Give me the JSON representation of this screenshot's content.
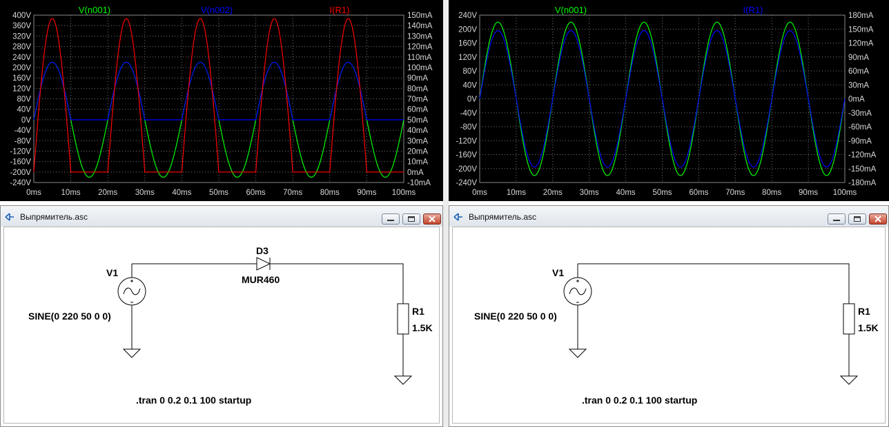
{
  "plots": [
    {
      "yLeftTicks": [
        "400V",
        "360V",
        "320V",
        "280V",
        "240V",
        "200V",
        "160V",
        "120V",
        "80V",
        "40V",
        "0V",
        "-40V",
        "-80V",
        "-120V",
        "-160V",
        "-200V",
        "-240V"
      ],
      "yRightTicks": [
        "150mA",
        "140mA",
        "130mA",
        "120mA",
        "110mA",
        "100mA",
        "90mA",
        "80mA",
        "70mA",
        "60mA",
        "50mA",
        "40mA",
        "30mA",
        "20mA",
        "10mA",
        "0mA",
        "-10mA"
      ],
      "xTicks": [
        "0ms",
        "10ms",
        "20ms",
        "30ms",
        "40ms",
        "50ms",
        "60ms",
        "70ms",
        "80ms",
        "90ms",
        "100ms"
      ],
      "traces": [
        {
          "label": "V(n001)",
          "color": "#00ff00"
        },
        {
          "label": "V(n002)",
          "color": "#0000ff"
        },
        {
          "label": "I(R1)",
          "color": "#ff0000"
        }
      ]
    },
    {
      "yLeftTicks": [
        "240V",
        "200V",
        "160V",
        "120V",
        "80V",
        "40V",
        "0V",
        "-40V",
        "-80V",
        "-120V",
        "-160V",
        "-200V",
        "-240V"
      ],
      "yRightTicks": [
        "180mA",
        "150mA",
        "120mA",
        "90mA",
        "60mA",
        "30mA",
        "0mA",
        "-30mA",
        "-60mA",
        "-90mA",
        "-120mA",
        "-150mA",
        "-180mA"
      ],
      "xTicks": [
        "0ms",
        "10ms",
        "20ms",
        "30ms",
        "40ms",
        "50ms",
        "60ms",
        "70ms",
        "80ms",
        "90ms",
        "100ms"
      ],
      "traces": [
        {
          "label": "V(n001)",
          "color": "#00ff00"
        },
        {
          "label": "I(R1)",
          "color": "#0000ff"
        }
      ]
    }
  ],
  "schematics": [
    {
      "title": "Выпрямитель.asc",
      "source": {
        "name": "V1",
        "value": "SINE(0 220 50 0 0)"
      },
      "diode": {
        "name": "D3",
        "model": "MUR460"
      },
      "resistor": {
        "name": "R1",
        "value": "1.5K"
      },
      "directive": ".tran 0 0.2 0.1 100 startup"
    },
    {
      "title": "Выпрямитель.asc",
      "source": {
        "name": "V1",
        "value": "SINE(0 220 50 0 0)"
      },
      "resistor": {
        "name": "R1",
        "value": "1.5K"
      },
      "directive": ".tran 0 0.2 0.1 100 startup"
    }
  ]
}
